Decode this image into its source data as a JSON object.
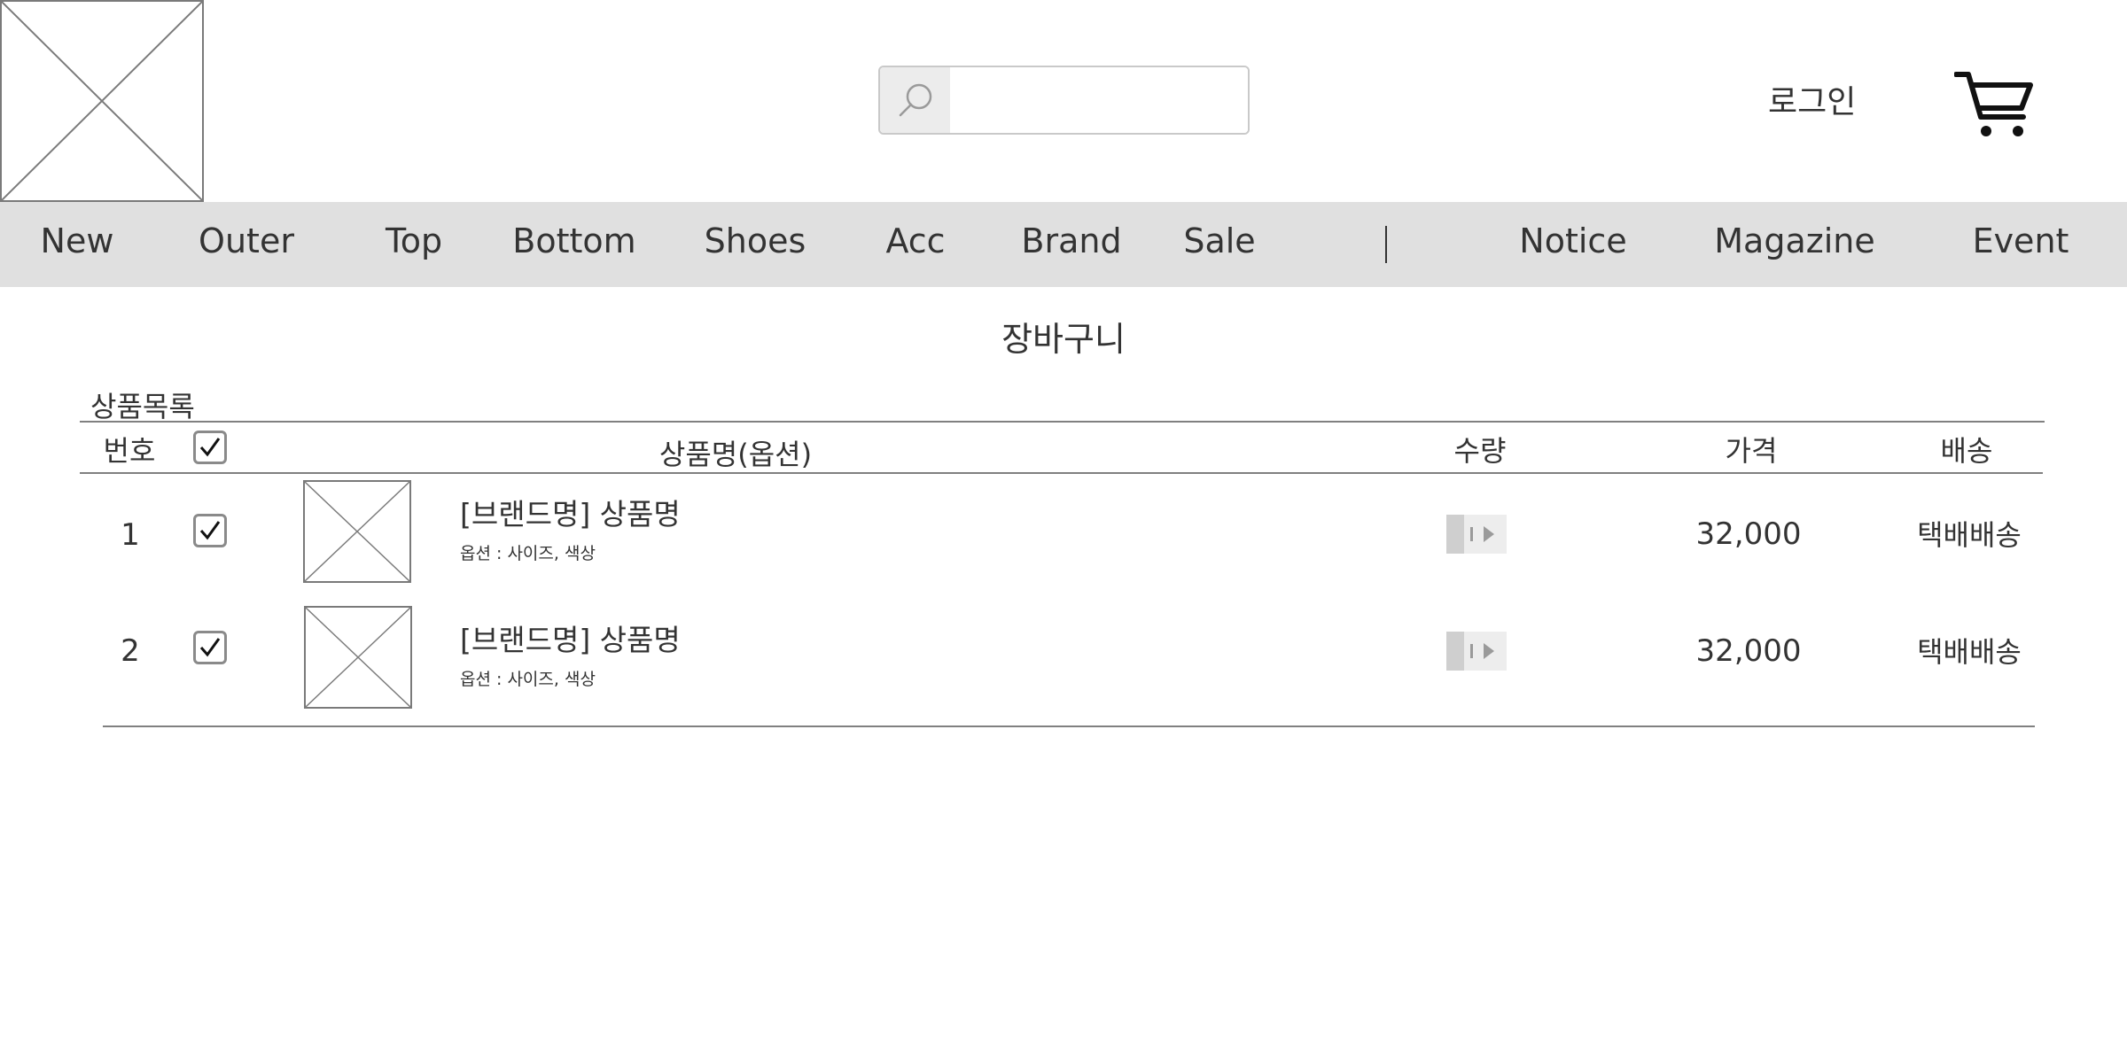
{
  "header": {
    "logo_icon": "image-placeholder-icon",
    "search": {
      "icon": "search-icon",
      "placeholder": "",
      "value": ""
    },
    "login_label": "로그인",
    "cart_icon": "shopping-cart-icon"
  },
  "nav": {
    "items": [
      "New",
      "Outer",
      "Top",
      "Bottom",
      "Shoes",
      "Acc",
      "Brand",
      "Sale"
    ],
    "secondary_items": [
      "Notice",
      "Magazine",
      "Event"
    ],
    "divider": "|"
  },
  "page_title": "장바구니",
  "cart": {
    "list_label": "상품목록",
    "columns": {
      "number": "번호",
      "name": "상품명(옵션)",
      "quantity": "수량",
      "price": "가격",
      "shipping": "배송"
    },
    "select_all_checked": true,
    "items": [
      {
        "number": "1",
        "checked": true,
        "name": "[브랜드명] 상품명",
        "option": "옵션 : 사이즈, 색상",
        "price": "32,000",
        "shipping": "택배배송"
      },
      {
        "number": "2",
        "checked": true,
        "name": "[브랜드명] 상품명",
        "option": "옵션 : 사이즈, 색상",
        "price": "32,000",
        "shipping": "택배배송"
      }
    ]
  },
  "colors": {
    "nav_background": "#e0e0e0",
    "search_button": "#ececec",
    "border": "#808080",
    "text": "#333333"
  }
}
